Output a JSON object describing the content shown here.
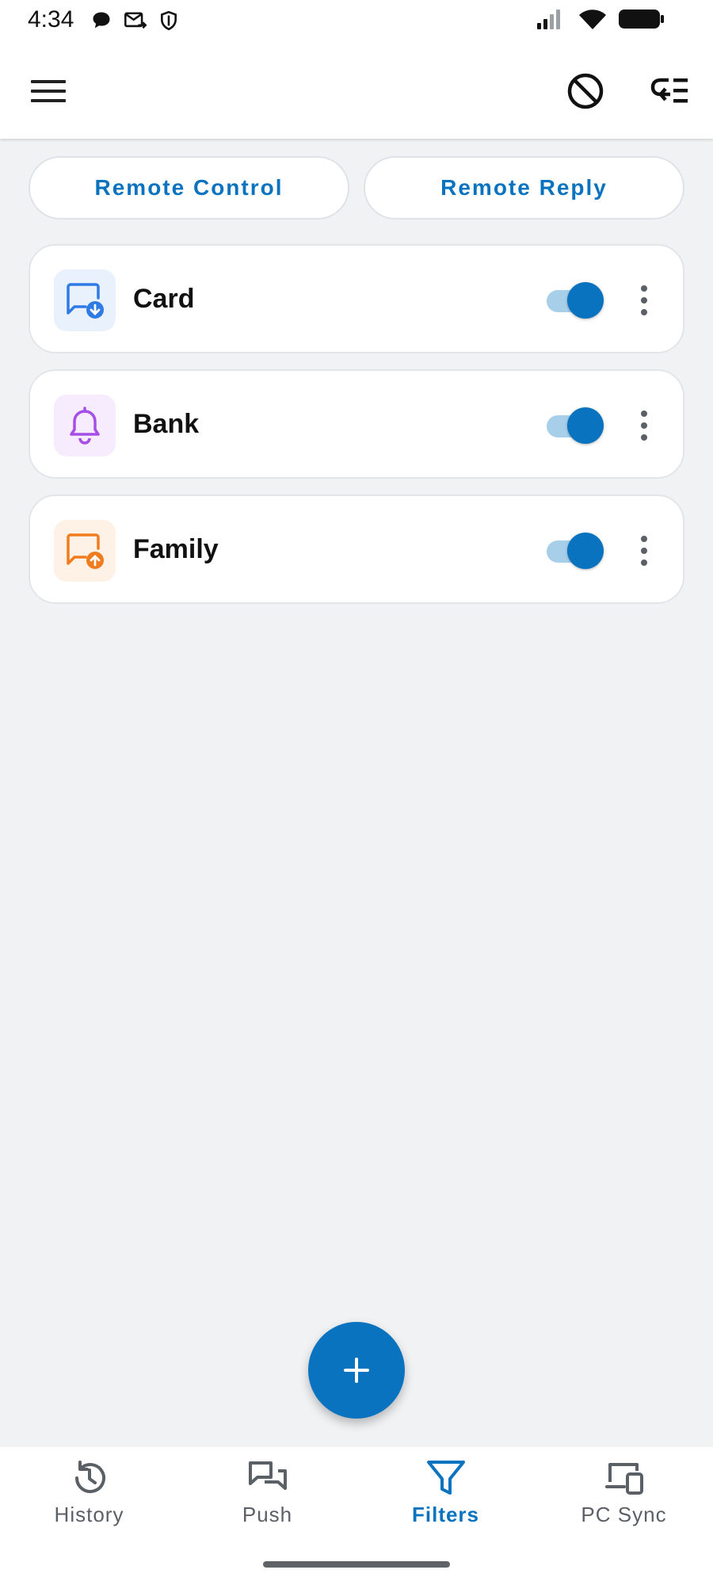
{
  "status_bar": {
    "time": "4:34",
    "left_icons": [
      "chat-bubble-icon",
      "mail-forward-icon",
      "shield-icon"
    ],
    "right_icons": [
      "cell-signal-icon",
      "wifi-icon",
      "battery-icon"
    ]
  },
  "app_bar": {
    "icons": [
      "menu-icon",
      "block-icon",
      "reply-list-icon"
    ]
  },
  "top_buttons": {
    "remote_control": "Remote Control",
    "remote_reply": "Remote Reply"
  },
  "filters": [
    {
      "name": "Card",
      "enabled": true,
      "icon": "message-download-icon",
      "color": "#2f7be6",
      "bg": "#e9f1fd"
    },
    {
      "name": "Bank",
      "enabled": true,
      "icon": "bell-icon",
      "color": "#a64ee8",
      "bg": "#f6ecfd"
    },
    {
      "name": "Family",
      "enabled": true,
      "icon": "message-upload-icon",
      "color": "#f07c1e",
      "bg": "#fef1e6"
    }
  ],
  "fab": {
    "icon": "plus-icon"
  },
  "bottom_nav": {
    "items": [
      {
        "label": "History",
        "icon": "history-icon",
        "active": false
      },
      {
        "label": "Push",
        "icon": "chat-bubbles-icon",
        "active": false
      },
      {
        "label": "Filters",
        "icon": "filter-icon",
        "active": true
      },
      {
        "label": "PC Sync",
        "icon": "devices-icon",
        "active": false
      }
    ]
  },
  "colors": {
    "accent": "#0a73bf",
    "toggle_track": "#a8cfea",
    "background": "#f1f2f4"
  }
}
